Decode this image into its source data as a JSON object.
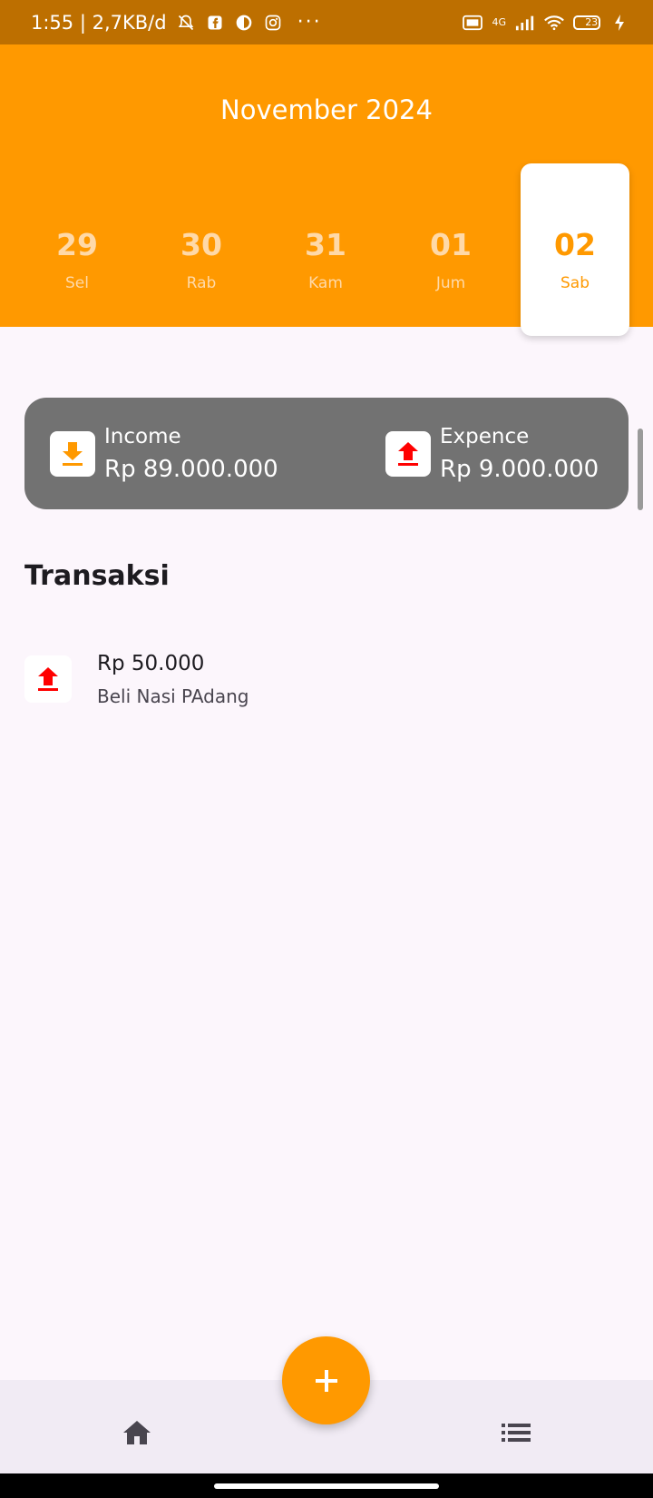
{
  "status_bar": {
    "time_speed": "1:55 | 2,7KB/d",
    "overflow": "···",
    "network_label": "4G",
    "battery_level": "23",
    "icons": [
      "mute-bell-icon",
      "facebook-icon",
      "app-icon",
      "instagram-icon",
      "volte-icon",
      "signal-icon",
      "wifi-icon",
      "battery-icon",
      "charging-icon"
    ]
  },
  "header": {
    "month": "November 2024",
    "days": [
      {
        "num": "29",
        "name": "Sel",
        "selected": false
      },
      {
        "num": "30",
        "name": "Rab",
        "selected": false
      },
      {
        "num": "31",
        "name": "Kam",
        "selected": false
      },
      {
        "num": "01",
        "name": "Jum",
        "selected": false
      },
      {
        "num": "02",
        "name": "Sab",
        "selected": true
      }
    ]
  },
  "summary": {
    "income_label": "Income",
    "income_value": "Rp 89.000.000",
    "expense_label": "Expence",
    "expense_value": "Rp 9.000.000"
  },
  "transactions": {
    "title": "Transaksi",
    "items": [
      {
        "amount": "Rp 50.000",
        "description": "Beli Nasi PAdang",
        "type": "expense"
      }
    ]
  },
  "colors": {
    "accent": "#ff9900",
    "status_bar": "#bd6f00",
    "card": "#727272",
    "expense_icon": "#ff0000",
    "background": "#fcf6fc"
  },
  "nav": {
    "icons": [
      "home-icon",
      "list-icon"
    ],
    "fab_icon": "plus-icon"
  }
}
